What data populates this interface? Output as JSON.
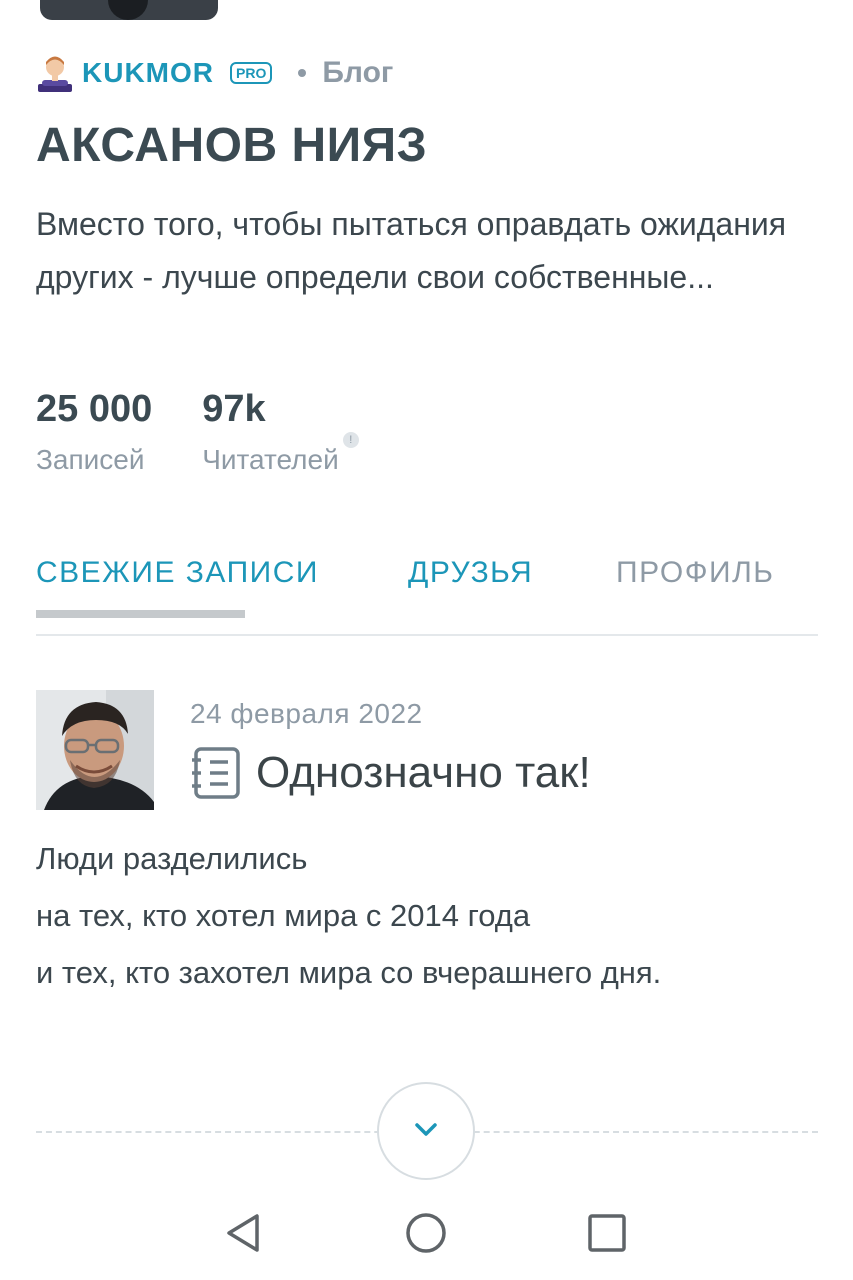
{
  "header": {
    "username": "KUKMOR",
    "badge": "PRO",
    "section": "Блог"
  },
  "blog": {
    "title": "АКСАНОВ НИЯЗ",
    "description": "Вместо того, чтобы пытаться оправдать ожидания других - лучше определи свои собственные..."
  },
  "stats": [
    {
      "value": "25 000",
      "label": "Записей"
    },
    {
      "value": "97k",
      "label": "Читателей",
      "info": "!"
    }
  ],
  "tabs": [
    {
      "label": "СВЕЖИЕ ЗАПИСИ",
      "active": true
    },
    {
      "label": "ДРУЗЬЯ",
      "active": false
    },
    {
      "label": "ПРОФИЛЬ",
      "active": false
    }
  ],
  "post": {
    "date": "24 февраля 2022",
    "title": "Однозначно так!",
    "type_icon": "notebook-icon",
    "lines": [
      "Люди разделились",
      "на тех, кто хотел мира с 2014 года",
      "и тех, кто захотел мира со вчерашнего дня."
    ]
  },
  "controls": {
    "expand_icon": "chevron-down-icon",
    "nav": [
      "back-triangle-icon",
      "home-circle-icon",
      "recent-square-icon"
    ]
  },
  "colors": {
    "accent": "#1c96b8",
    "muted": "#8e9aa5",
    "heading": "#3b4a52",
    "text": "#3c474e"
  }
}
